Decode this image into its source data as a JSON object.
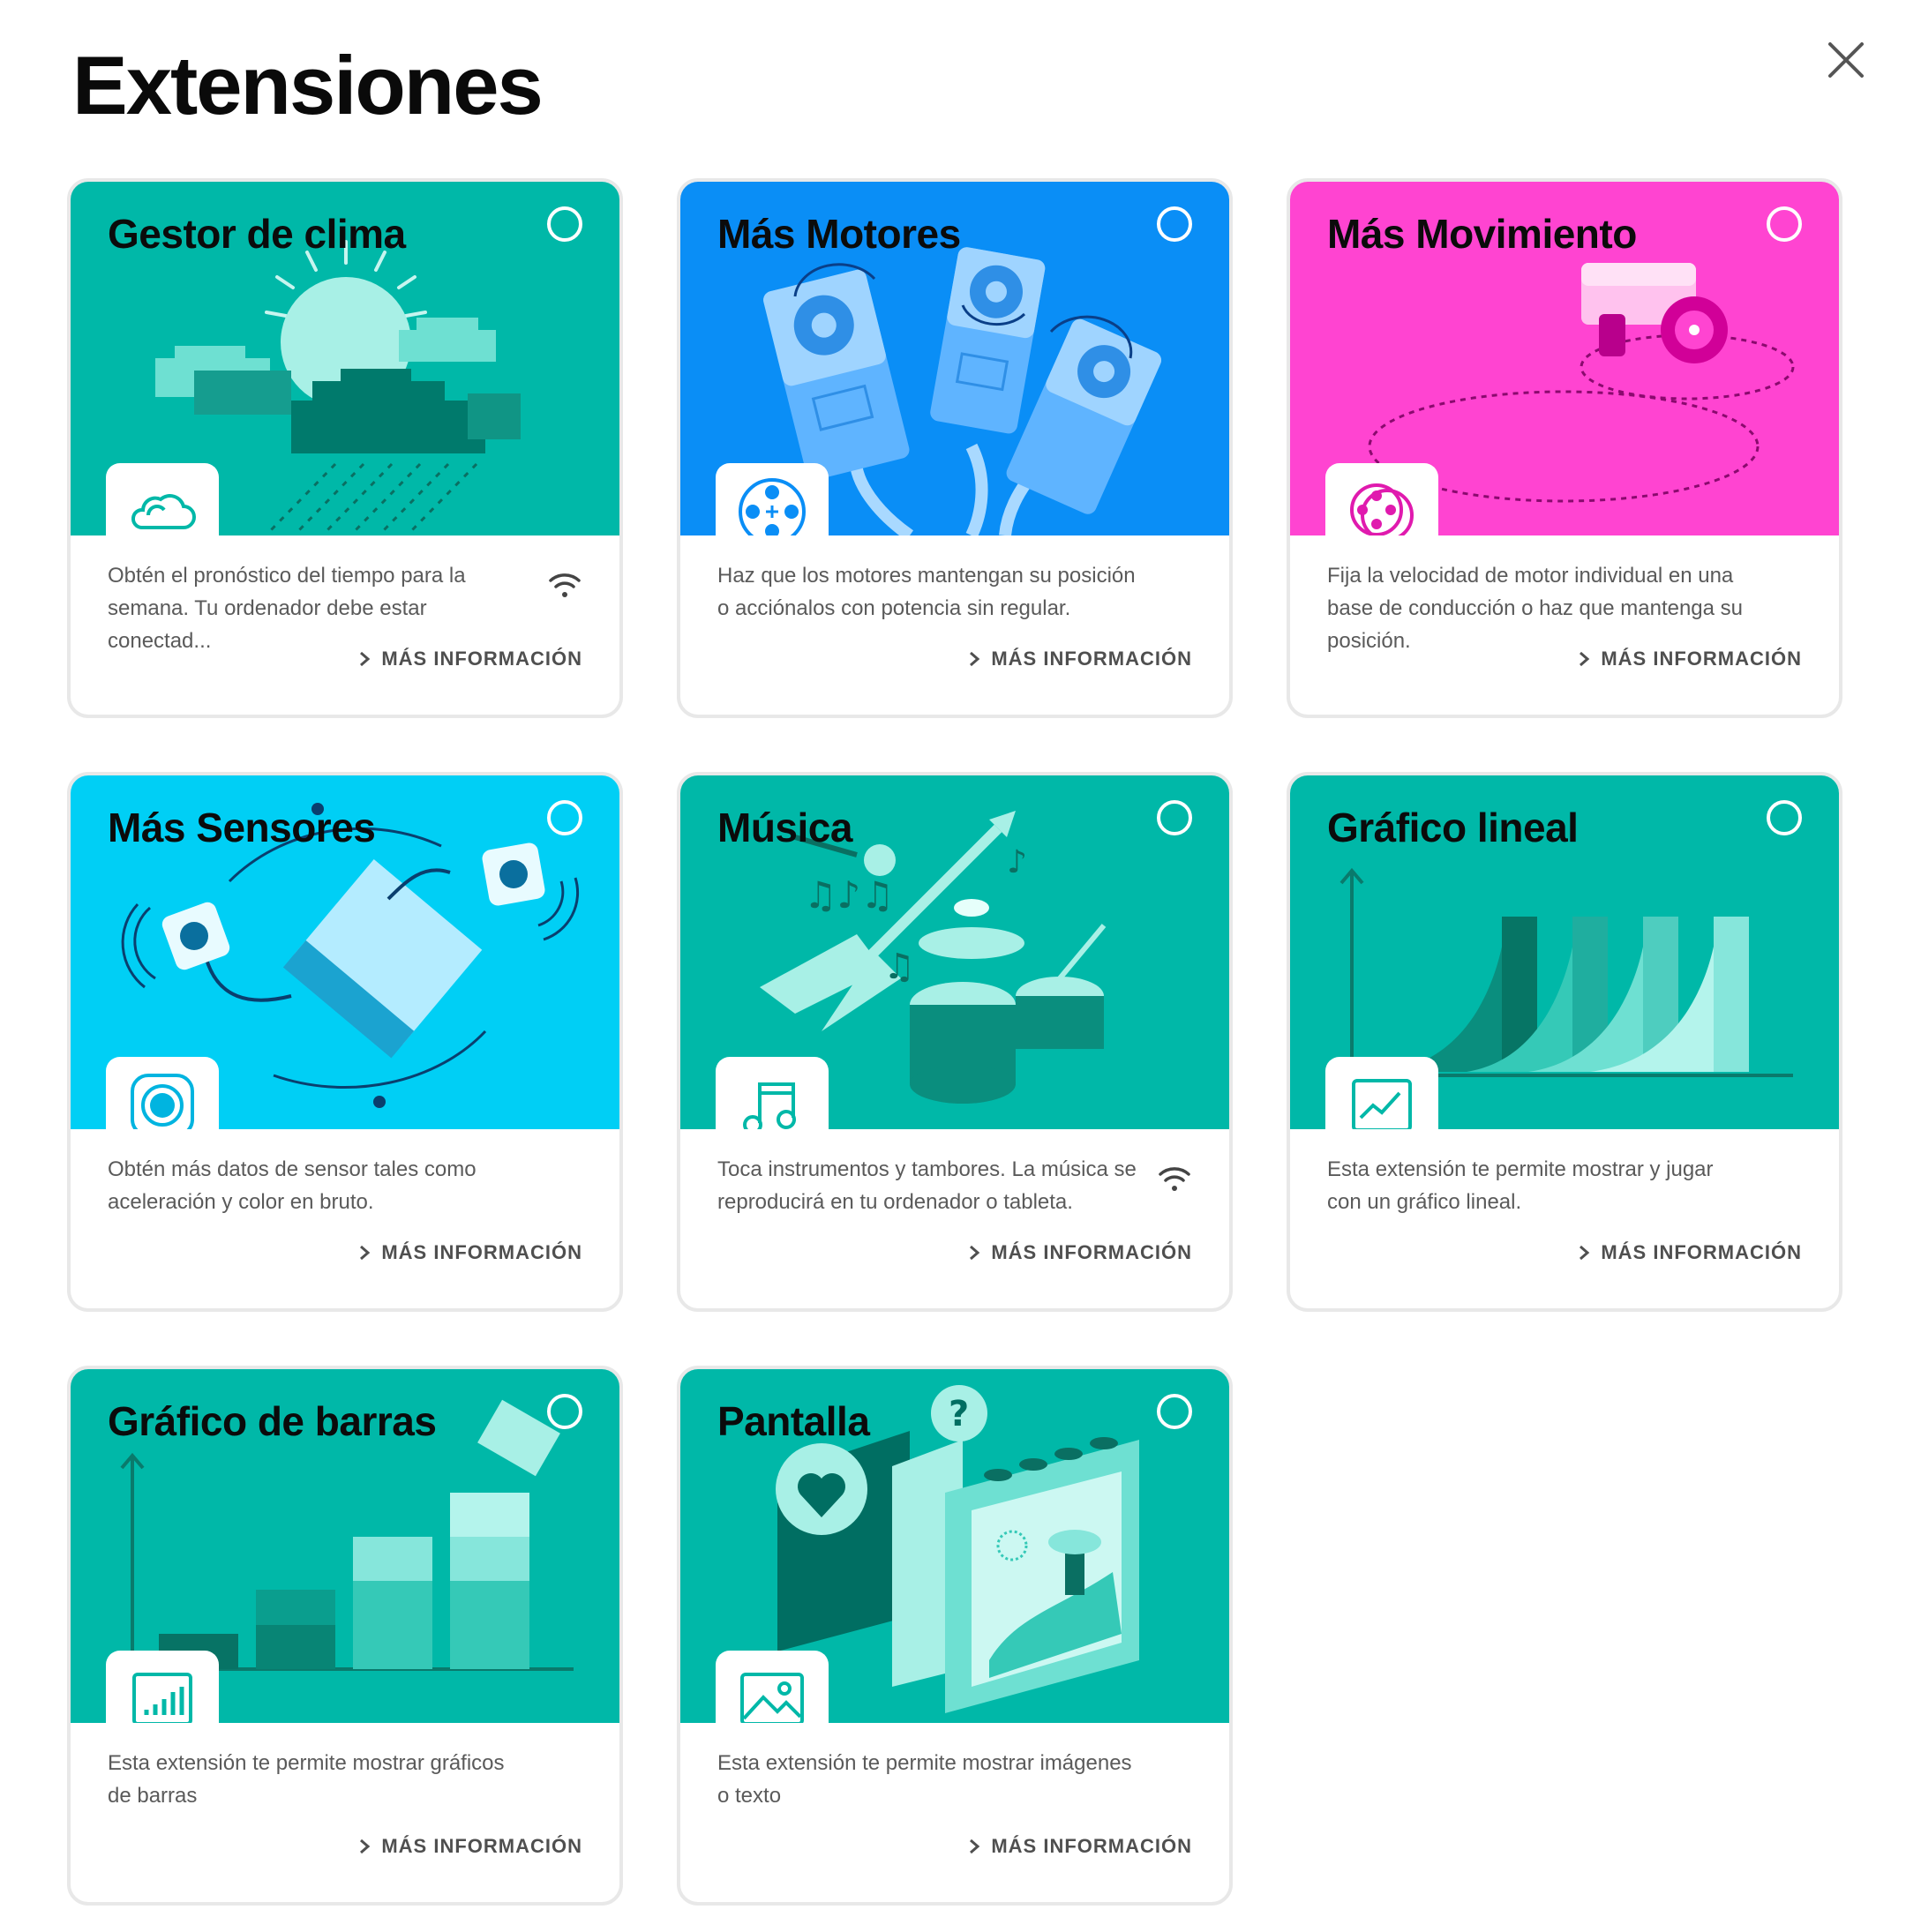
{
  "dialog": {
    "title": "Extensiones"
  },
  "colors": {
    "teal": "#00b8a8",
    "blue": "#0a8ef6",
    "magenta": "#ff44d1",
    "cyan": "#00cff5",
    "white": "#ffffff"
  },
  "cards": [
    {
      "title": "Gestor de clima",
      "description": "Obtén el pronóstico del tiempo para la semana. Tu ordenador debe estar conectad...",
      "more": "MÁS INFORMACIÓN",
      "icon": "cloud-icon",
      "requires_network": true
    },
    {
      "title": "Más Motores",
      "description": "Haz que los motores mantengan su posición o acciónalos con potencia sin regular.",
      "more": "MÁS INFORMACIÓN",
      "icon": "motor-icon",
      "requires_network": false
    },
    {
      "title": "Más Movimiento",
      "description": "Fija la velocidad de motor individual en una base de conducción o haz que mantenga su posición.",
      "more": "MÁS INFORMACIÓN",
      "icon": "motor-pair-icon",
      "requires_network": false
    },
    {
      "title": "Más Sensores",
      "description": "Obtén más datos de sensor tales como aceleración y color en bruto.",
      "more": "MÁS INFORMACIÓN",
      "icon": "sensor-icon",
      "requires_network": false
    },
    {
      "title": "Música",
      "description": "Toca instrumentos y tambores. La música se reproducirá en tu ordenador o tableta.",
      "more": "MÁS INFORMACIÓN",
      "icon": "music-note-icon",
      "requires_network": true
    },
    {
      "title": "Gráfico lineal",
      "description": "Esta extensión te permite mostrar y jugar con un gráfico lineal.",
      "more": "MÁS INFORMACIÓN",
      "icon": "line-chart-icon",
      "requires_network": false
    },
    {
      "title": "Gráfico de barras",
      "description": "Esta extensión te permite mostrar gráficos de barras",
      "more": "MÁS INFORMACIÓN",
      "icon": "bar-chart-icon",
      "requires_network": false
    },
    {
      "title": "Pantalla",
      "description": "Esta extensión te permite mostrar imágenes o texto",
      "more": "MÁS INFORMACIÓN",
      "icon": "image-icon",
      "requires_network": false
    }
  ]
}
